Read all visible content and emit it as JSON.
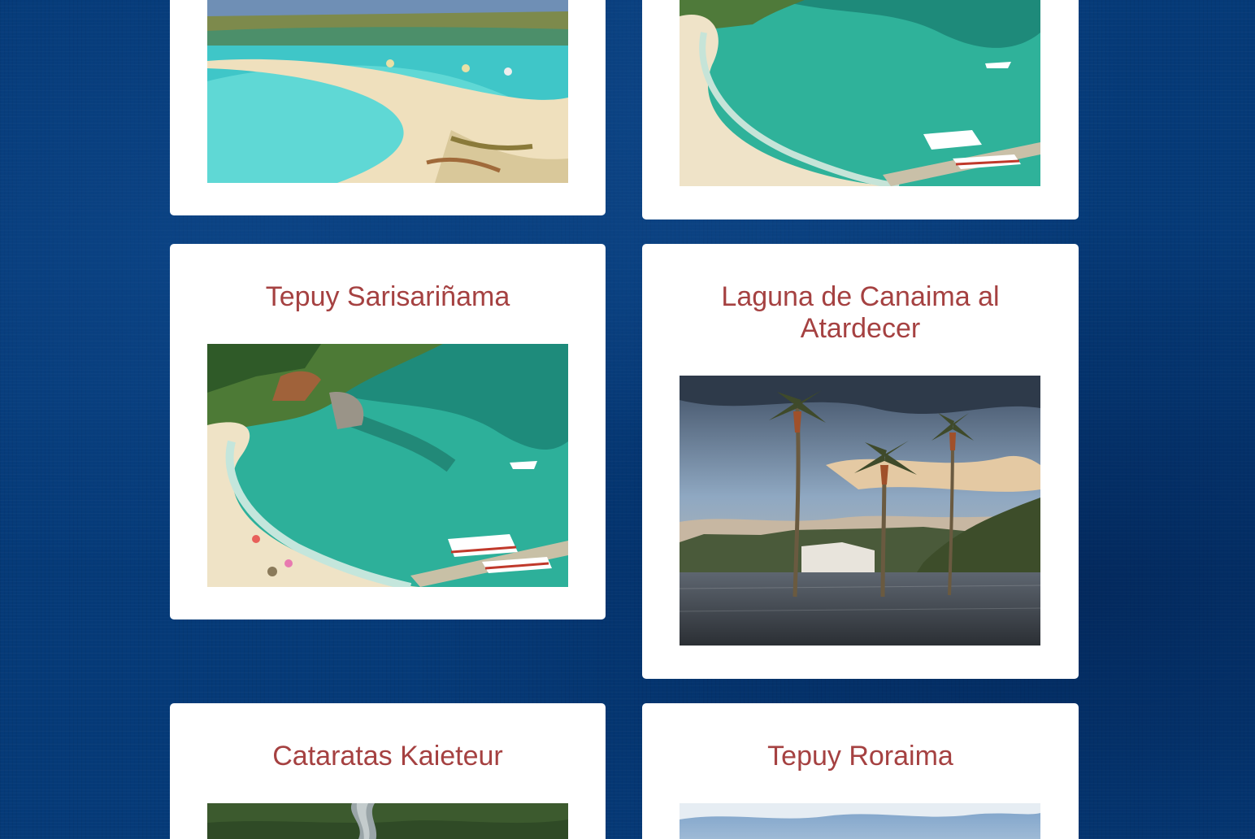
{
  "gallery": {
    "cards": [
      {
        "title": "",
        "image": "beach-sandbar-photo"
      },
      {
        "title": "",
        "image": "cove-beach-photo"
      },
      {
        "title": "Tepuy Sarisariñama",
        "image": "cove-beach-photo"
      },
      {
        "title": "Laguna de Canaima al Atardecer",
        "image": "canaima-lagoon-palms-photo"
      },
      {
        "title": "Cataratas Kaieteur",
        "image": "kaieteur-river-photo"
      },
      {
        "title": "Tepuy Roraima",
        "image": "roraima-sky-photo"
      }
    ]
  },
  "colors": {
    "background": "#053a78",
    "card": "#ffffff",
    "title": "#a54141"
  }
}
